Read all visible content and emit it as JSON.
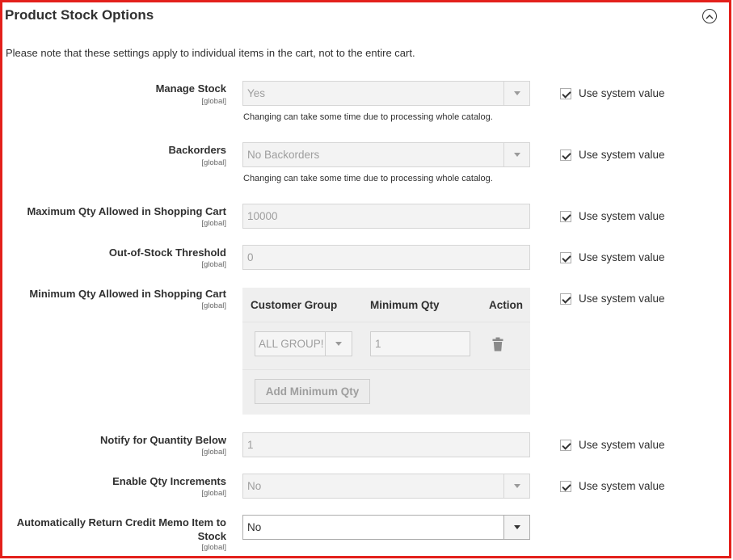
{
  "section": {
    "title": "Product Stock Options",
    "collapse_icon": "chevron-up-circle-icon",
    "note": "Please note that these settings apply to individual items in the cart, not to the entire cart."
  },
  "system_value_label": "Use system value",
  "fields": {
    "manage_stock": {
      "label": "Manage Stock",
      "scope": "[global]",
      "value": "Yes",
      "hint": "Changing can take some time due to processing whole catalog."
    },
    "backorders": {
      "label": "Backorders",
      "scope": "[global]",
      "value": "No Backorders",
      "hint": "Changing can take some time due to processing whole catalog."
    },
    "max_qty": {
      "label": "Maximum Qty Allowed in Shopping Cart",
      "scope": "[global]",
      "value": "10000"
    },
    "oos_threshold": {
      "label": "Out-of-Stock Threshold",
      "scope": "[global]",
      "value": "0"
    },
    "min_qty": {
      "label": "Minimum Qty Allowed in Shopping Cart",
      "scope": "[global]",
      "columns": [
        "Customer Group",
        "Minimum Qty",
        "Action"
      ],
      "row": {
        "group": "ALL GROUP!",
        "qty": "1"
      },
      "add_button": "Add Minimum Qty"
    },
    "notify_below": {
      "label": "Notify for Quantity Below",
      "scope": "[global]",
      "value": "1"
    },
    "qty_increments": {
      "label": "Enable Qty Increments",
      "scope": "[global]",
      "value": "No"
    },
    "auto_return": {
      "label_line1": "Automatically Return Credit Memo Item to",
      "label_line2": "Stock",
      "scope": "[global]",
      "value": "No"
    }
  },
  "colors": {
    "border": "#e3201b",
    "disabled_bg": "#f3f3f3",
    "grid_bg": "#efefef"
  }
}
